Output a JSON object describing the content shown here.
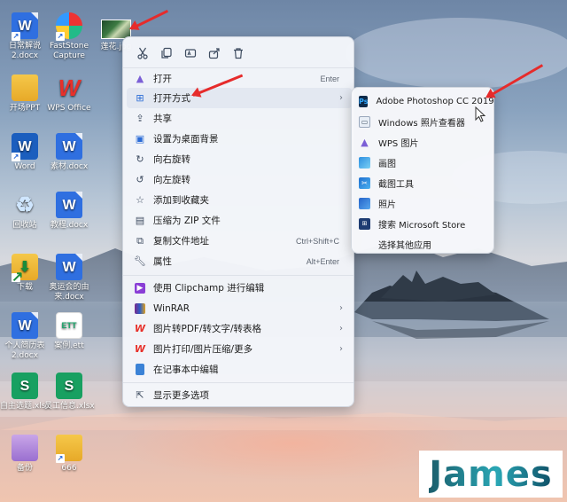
{
  "desktop": {
    "icons": [
      {
        "label": "日常解说\n2.docx",
        "icon": "wps-word-doc-icon"
      },
      {
        "label": "FastStone\nCapture",
        "icon": "faststone-capture-icon"
      },
      {
        "label": "莲花.jpg",
        "icon": "image-thumbnail-icon"
      },
      {
        "label": "开场PPT",
        "icon": "folder-icon"
      },
      {
        "label": "WPS Office",
        "icon": "wps-office-icon"
      },
      {
        "label": "Word",
        "icon": "microsoft-word-icon"
      },
      {
        "label": "素材.docx",
        "icon": "wps-word-doc-icon"
      },
      {
        "label": "回收站",
        "icon": "recycle-bin-icon"
      },
      {
        "label": "教程.docx",
        "icon": "wps-word-doc-icon"
      },
      {
        "label": "下载",
        "icon": "download-folder-icon"
      },
      {
        "label": "奥运会的由\n来.docx",
        "icon": "wps-word-doc-icon"
      },
      {
        "label": "个人简历表\n2.docx",
        "icon": "wps-word-doc-icon"
      },
      {
        "label": "案例.ett",
        "icon": "wps-ett-icon"
      },
      {
        "label": "自主选题.xlsx",
        "icon": "wps-sheet-icon"
      },
      {
        "label": "员工信息.xlsx",
        "icon": "wps-sheet-icon"
      },
      {
        "label": "备份",
        "icon": "folder-icon"
      },
      {
        "label": "666",
        "icon": "folder-icon"
      }
    ]
  },
  "context_menu": {
    "toolbar": [
      {
        "name": "cut",
        "icon": "scissors-icon"
      },
      {
        "name": "copy",
        "icon": "copy-icon"
      },
      {
        "name": "rename",
        "icon": "rename-icon"
      },
      {
        "name": "share",
        "icon": "share-icon"
      },
      {
        "name": "delete",
        "icon": "trash-icon"
      }
    ],
    "items": [
      {
        "label": "打开",
        "shortcut": "Enter",
        "icon": "photos-open-icon"
      },
      {
        "label": "打开方式",
        "shortcut": "",
        "icon": "open-with-icon",
        "submenu": true,
        "highlighted": true
      },
      {
        "label": "共享",
        "shortcut": "",
        "icon": "share-icon"
      },
      {
        "label": "设置为桌面背景",
        "shortcut": "",
        "icon": "desktop-background-icon"
      },
      {
        "label": "向右旋转",
        "shortcut": "",
        "icon": "rotate-right-icon"
      },
      {
        "label": "向左旋转",
        "shortcut": "",
        "icon": "rotate-left-icon"
      },
      {
        "label": "添加到收藏夹",
        "shortcut": "",
        "icon": "star-icon"
      },
      {
        "label": "压缩为 ZIP 文件",
        "shortcut": "",
        "icon": "zip-icon"
      },
      {
        "label": "复制文件地址",
        "shortcut": "Ctrl+Shift+C",
        "icon": "copy-path-icon"
      },
      {
        "label": "属性",
        "shortcut": "Alt+Enter",
        "icon": "wrench-icon"
      },
      {
        "label": "使用 Clipchamp 进行编辑",
        "shortcut": "",
        "icon": "clipchamp-icon"
      },
      {
        "label": "WinRAR",
        "shortcut": "",
        "icon": "winrar-icon",
        "submenu": true
      },
      {
        "label": "图片转PDF/转文字/转表格",
        "shortcut": "",
        "icon": "wps-icon",
        "submenu": true
      },
      {
        "label": "图片打印/图片压缩/更多",
        "shortcut": "",
        "icon": "wps-icon",
        "submenu": true
      },
      {
        "label": "在记事本中编辑",
        "shortcut": "",
        "icon": "notepad-icon"
      },
      {
        "label": "显示更多选项",
        "shortcut": "",
        "icon": "more-options-icon"
      }
    ],
    "submenu": [
      {
        "label": "Adobe Photoshop CC 2019",
        "icon": "photoshop-icon"
      },
      {
        "label": "Windows 照片查看器",
        "icon": "photo-viewer-icon"
      },
      {
        "label": "WPS 图片",
        "icon": "wps-pictures-icon"
      },
      {
        "label": "画图",
        "icon": "paint-icon"
      },
      {
        "label": "截图工具",
        "icon": "snipping-tool-icon"
      },
      {
        "label": "照片",
        "icon": "photos-icon"
      },
      {
        "label": "搜索 Microsoft Store",
        "icon": "store-icon"
      },
      {
        "label": "选择其他应用",
        "icon": ""
      }
    ]
  },
  "watermark": {
    "text": "James"
  },
  "colors": {
    "arrow": "#e62b2b",
    "menu_bg": "#f4f6fa",
    "highlight": "#e3e8f1"
  }
}
